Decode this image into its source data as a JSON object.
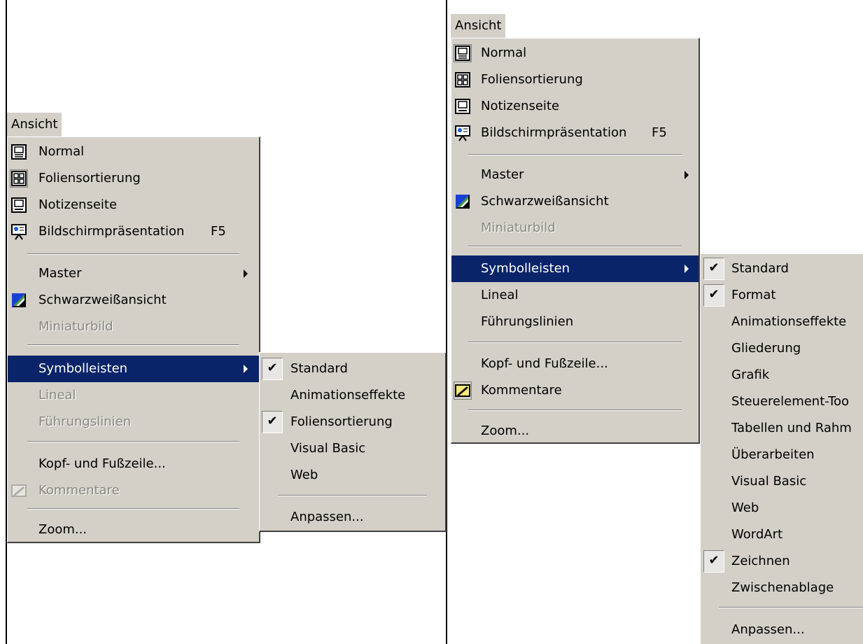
{
  "left": {
    "menubar_title": "Ansicht",
    "items": [
      {
        "label": "Normal",
        "icon": "normal-view-icon"
      },
      {
        "label": "Foliensortierung",
        "icon": "slide-sorter-icon"
      },
      {
        "label": "Notizenseite",
        "icon": "notes-page-icon"
      },
      {
        "label": "Bildschirmpräsentation",
        "shortcut": "F5",
        "icon": "slideshow-icon"
      },
      {
        "label": "Master"
      },
      {
        "label": "Schwarzweißansicht",
        "icon": "black-white-icon"
      },
      {
        "label": "Miniaturbild",
        "disabled": true
      },
      {
        "label": "Symbolleisten",
        "selected": true
      },
      {
        "label": "Lineal",
        "disabled": true
      },
      {
        "label": "Führungslinien",
        "disabled": true
      },
      {
        "label": "Kopf- und Fußzeile..."
      },
      {
        "label": "Kommentare",
        "disabled": true,
        "icon": "comments-icon"
      },
      {
        "label": "Zoom..."
      }
    ],
    "submenu": [
      {
        "label": "Standard",
        "checked": true
      },
      {
        "label": "Animationseffekte"
      },
      {
        "label": "Foliensortierung",
        "checked": true
      },
      {
        "label": "Visual Basic"
      },
      {
        "label": "Web"
      },
      {
        "label": "Anpassen..."
      }
    ]
  },
  "right": {
    "menubar_title": "Ansicht",
    "items": [
      {
        "label": "Normal",
        "icon": "normal-view-icon"
      },
      {
        "label": "Foliensortierung",
        "icon": "slide-sorter-icon"
      },
      {
        "label": "Notizenseite",
        "icon": "notes-page-icon"
      },
      {
        "label": "Bildschirmpräsentation",
        "shortcut": "F5",
        "icon": "slideshow-icon"
      },
      {
        "label": "Master"
      },
      {
        "label": "Schwarzweißansicht",
        "icon": "black-white-icon"
      },
      {
        "label": "Miniaturbild",
        "disabled": true
      },
      {
        "label": "Symbolleisten",
        "selected": true
      },
      {
        "label": "Lineal"
      },
      {
        "label": "Führungslinien"
      },
      {
        "label": "Kopf- und Fußzeile..."
      },
      {
        "label": "Kommentare",
        "icon": "comments-icon"
      },
      {
        "label": "Zoom..."
      }
    ],
    "submenu": [
      {
        "label": "Standard",
        "checked": true
      },
      {
        "label": "Format",
        "checked": true
      },
      {
        "label": "Animationseffekte"
      },
      {
        "label": "Gliederung"
      },
      {
        "label": "Grafik"
      },
      {
        "label": "Steuerelement-Too"
      },
      {
        "label": "Tabellen und Rahm"
      },
      {
        "label": "Überarbeiten"
      },
      {
        "label": "Visual Basic"
      },
      {
        "label": "Web"
      },
      {
        "label": "WordArt"
      },
      {
        "label": "Zeichnen",
        "checked": true
      },
      {
        "label": "Zwischenablage"
      },
      {
        "label": "Anpassen..."
      }
    ]
  },
  "colors": {
    "menu_bg": "#d4d0c8",
    "highlight": "#0a246a",
    "disabled_text": "#8a8680"
  }
}
